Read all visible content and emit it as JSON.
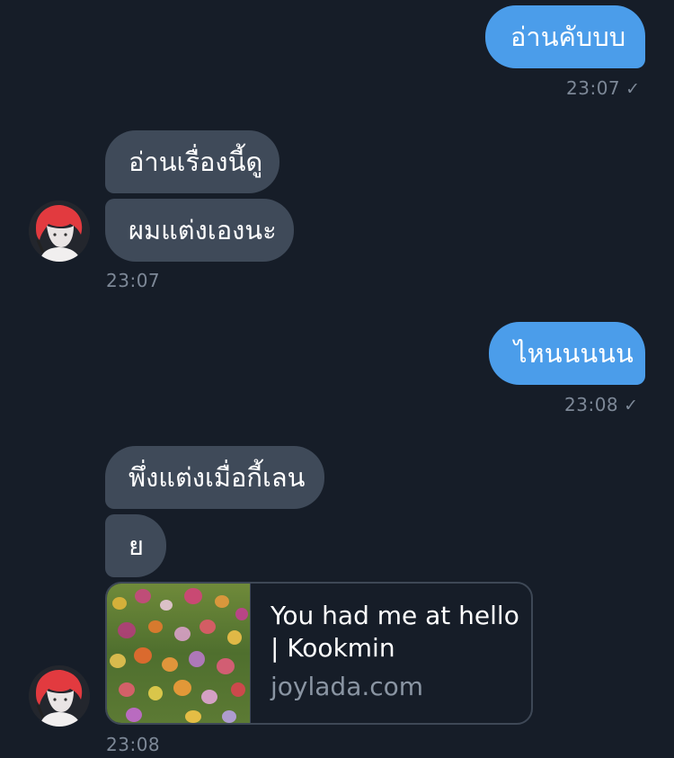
{
  "messages": {
    "m1": {
      "text": "อ่านคับบบ",
      "time": "23:07",
      "read_mark": "✓"
    },
    "m2": {
      "text": "อ่านเรื่องนี้ดู"
    },
    "m3": {
      "text": "ผมแต่งเองนะ",
      "time": "23:07"
    },
    "m4": {
      "text": "ไหนนนนน",
      "time": "23:08",
      "read_mark": "✓"
    },
    "m5": {
      "text": "พึ่งแต่งเมื่อกี้เลน"
    },
    "m6": {
      "text": "ย"
    },
    "m7": {
      "title": "You had me at hello\n| Kookmin",
      "domain": "joylada.com",
      "time": "23:08"
    }
  },
  "colors": {
    "background": "#161d28",
    "outgoing_bubble": "#4b9dea",
    "incoming_bubble": "#3f4a59",
    "timestamp": "#7d8897"
  },
  "icons": {
    "avatar": "contact-avatar",
    "read_mark": "check-icon",
    "link_thumbnail": "tulip-field-thumbnail"
  }
}
